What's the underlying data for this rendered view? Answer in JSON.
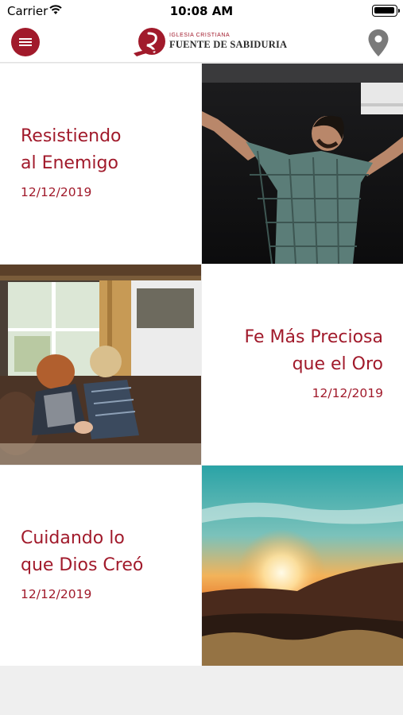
{
  "status_bar": {
    "carrier": "Carrier",
    "time": "10:08 AM"
  },
  "header": {
    "logo_small": "IGLESIA CRISTIANA",
    "logo_big": "FUENTE DE SABIDURIA",
    "brand_color": "#a11a2b"
  },
  "posts": [
    {
      "title_line1": "Resistiendo",
      "title_line2": "al Enemigo",
      "date": "12/12/2019",
      "image": "man-worship-arms-raised"
    },
    {
      "title_line1": "Fe Más Preciosa",
      "title_line2": "que el Oro",
      "date": "12/12/2019",
      "image": "two-women-praying-couch"
    },
    {
      "title_line1": "Cuidando lo",
      "title_line2": "que Dios Creó",
      "date": "12/12/2019",
      "image": "sunset-over-mountains"
    }
  ]
}
